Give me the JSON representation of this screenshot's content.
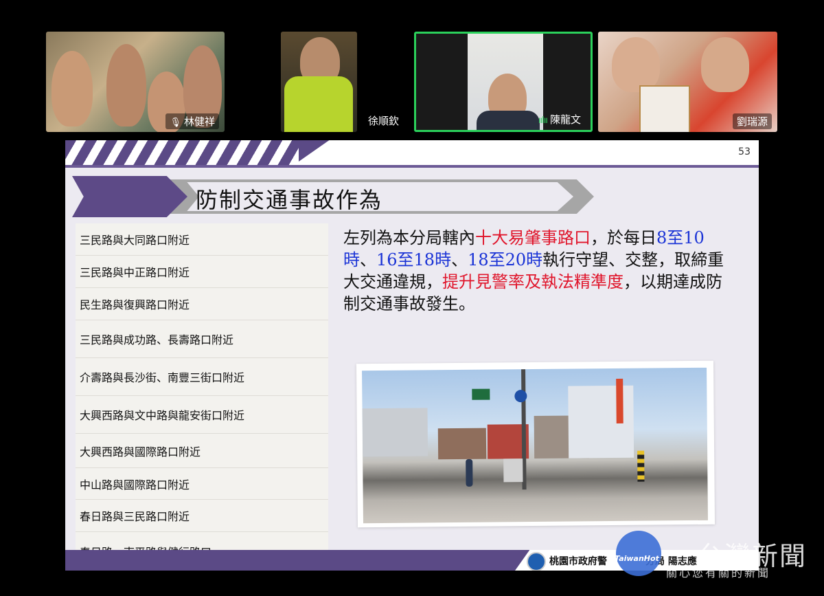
{
  "participants": [
    {
      "name": "林健祥",
      "muted": true
    },
    {
      "name": "徐順欽",
      "muted": false
    },
    {
      "name": "陳龍文",
      "speaking": true
    },
    {
      "name": "劉瑞源",
      "muted": false
    }
  ],
  "slide": {
    "page_number": "53",
    "title": "防制交通事故作為",
    "intersections": [
      "三民路與大同路口附近",
      "三民路與中正路口附近",
      "民生路與復興路口附近",
      "三民路與成功路、長壽路口附近",
      "介壽路與長沙街、南豐三街口附近",
      "大興西路與文中路與龍安街口附近",
      "大興西路與國際路口附近",
      "中山路與國際路口附近",
      "春日路與三民路口附近",
      "春日路、南平路與健行路口"
    ],
    "paragraph": {
      "p1": "左列為本分局轄內",
      "p2": "十大易肇事路口",
      "p3": "，於每日",
      "p4": "8至10時",
      "p5": "、",
      "p6": "16至18時",
      "p7": "、",
      "p8": "18至20時",
      "p9": "執行守望、交整，取締重大交通違規，",
      "p10": "提升見警率及執法精準度",
      "p11": "，以期達成防制交通事故發生。"
    },
    "footer": "桃園市政府警　　　　分局 陽志應"
  },
  "watermark": {
    "logo": "TaiwanHot",
    "title": "台灣新聞",
    "subtitle": "關心您有關的新聞"
  },
  "colors": {
    "accent_purple": "#5b4a86",
    "highlight_red": "#e0152b",
    "highlight_blue": "#1a33d6",
    "speaker_border": "#2bd15b"
  }
}
